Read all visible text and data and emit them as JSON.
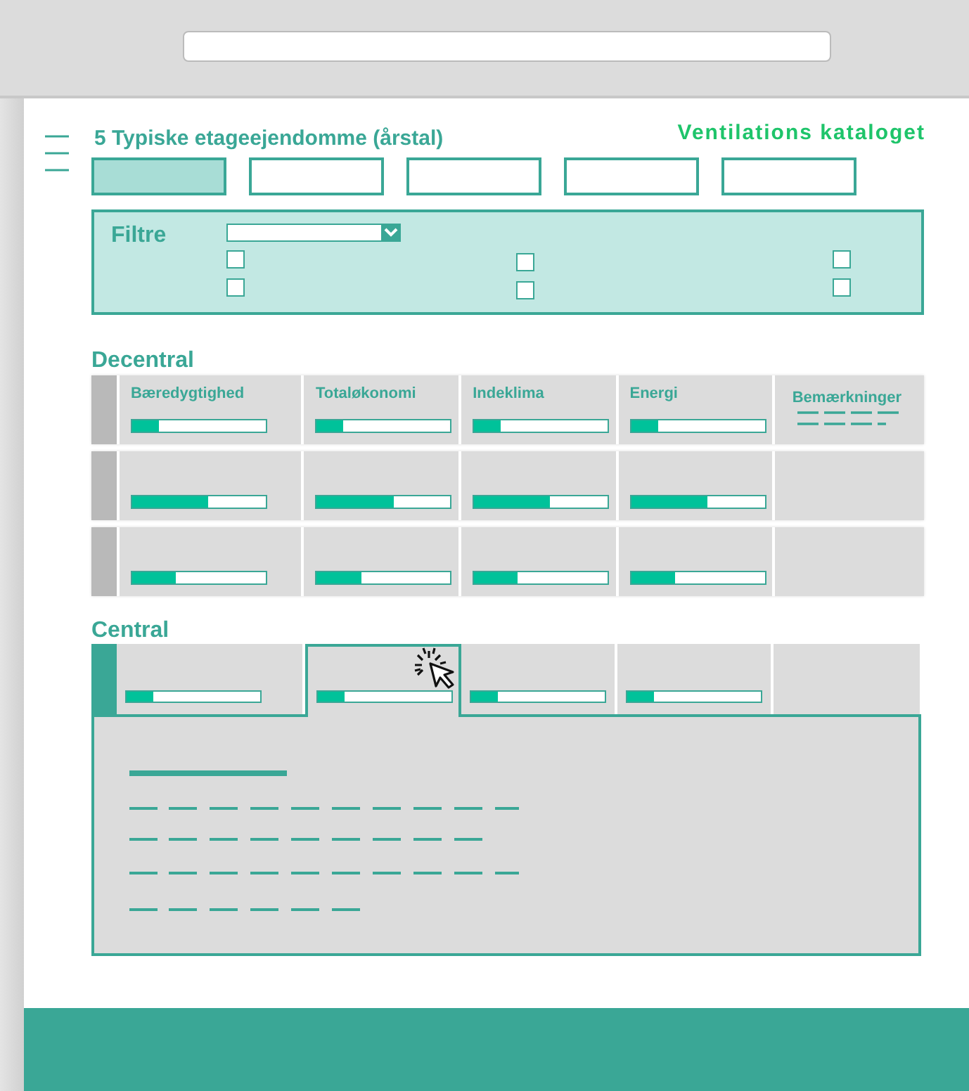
{
  "header": {
    "title": "5 Typiske etageejendomme (årstal)",
    "logo": "Ventilations kataloget"
  },
  "tabs": [
    {
      "selected": true
    },
    {
      "selected": false
    },
    {
      "selected": false
    },
    {
      "selected": false
    },
    {
      "selected": false
    }
  ],
  "filters": {
    "label": "Filtre",
    "checkboxes": [
      {
        "checked": false
      },
      {
        "checked": false
      },
      {
        "checked": false
      },
      {
        "checked": false
      },
      {
        "checked": false
      },
      {
        "checked": false
      }
    ]
  },
  "decentral": {
    "title": "Decentral",
    "columns": [
      "Bæredygtighed",
      "Totaløkonomi",
      "Indeklima",
      "Energi",
      "Bemærkninger"
    ],
    "rows": [
      {
        "expanded": false,
        "cells": [
          {
            "level": 0.2
          },
          {
            "level": 0.2
          },
          {
            "level": 0.2
          },
          {
            "level": 0.2
          }
        ]
      },
      {
        "expanded": false,
        "cells": [
          {
            "level": 0.57
          },
          {
            "level": 0.57
          },
          {
            "level": 0.57
          },
          {
            "level": 0.57
          }
        ]
      },
      {
        "expanded": false,
        "cells": [
          {
            "level": 0.33
          },
          {
            "level": 0.33
          },
          {
            "level": 0.33
          },
          {
            "level": 0.33
          }
        ]
      }
    ]
  },
  "central": {
    "title": "Central",
    "expanded": true,
    "cells": [
      {
        "level": 0.2,
        "selected": false
      },
      {
        "level": 0.2,
        "selected": true
      },
      {
        "level": 0.2,
        "selected": false
      },
      {
        "level": 0.2,
        "selected": false
      }
    ]
  }
}
